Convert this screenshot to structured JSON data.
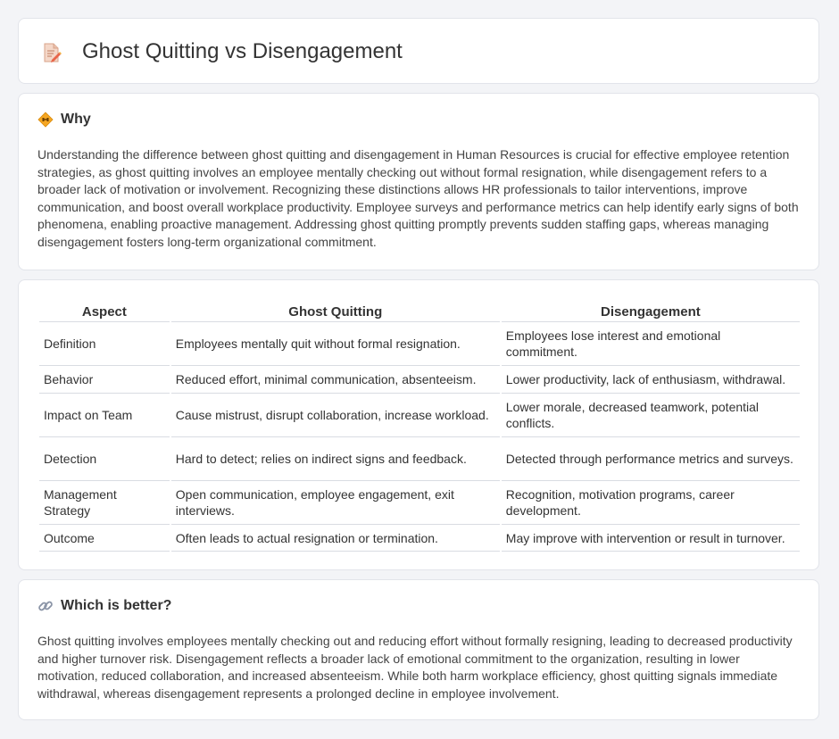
{
  "header": {
    "title": "Ghost Quitting vs Disengagement",
    "icon": "document-pencil-icon"
  },
  "why": {
    "heading": "Why",
    "icon": "road-sign-icon",
    "text": "Understanding the difference between ghost quitting and disengagement in Human Resources is crucial for effective employee retention strategies, as ghost quitting involves an employee mentally checking out without formal resignation, while disengagement refers to a broader lack of motivation or involvement. Recognizing these distinctions allows HR professionals to tailor interventions, improve communication, and boost overall workplace productivity. Employee surveys and performance metrics can help identify early signs of both phenomena, enabling proactive management. Addressing ghost quitting promptly prevents sudden staffing gaps, whereas managing disengagement fosters long-term organizational commitment."
  },
  "table": {
    "headers": [
      "Aspect",
      "Ghost Quitting",
      "Disengagement"
    ],
    "rows": [
      [
        "Definition",
        "Employees mentally quit without formal resignation.",
        "Employees lose interest and emotional commitment."
      ],
      [
        "Behavior",
        "Reduced effort, minimal communication, absenteeism.",
        "Lower productivity, lack of enthusiasm, withdrawal."
      ],
      [
        "Impact on Team",
        "Cause mistrust, disrupt collaboration, increase workload.",
        "Lower morale, decreased teamwork, potential conflicts."
      ],
      [
        "Detection",
        "Hard to detect; relies on indirect signs and feedback.",
        "Detected through performance metrics and surveys."
      ],
      [
        "Management Strategy",
        "Open communication, employee engagement, exit interviews.",
        "Recognition, motivation programs, career development."
      ],
      [
        "Outcome",
        "Often leads to actual resignation or termination.",
        "May improve with intervention or result in turnover."
      ]
    ]
  },
  "better": {
    "heading": "Which is better?",
    "icon": "link-icon",
    "text": "Ghost quitting involves employees mentally checking out and reducing effort without formally resigning, leading to decreased productivity and higher turnover risk. Disengagement reflects a broader lack of emotional commitment to the organization, resulting in lower motivation, reduced collaboration, and increased absenteeism. While both harm workplace efficiency, ghost quitting signals immediate withdrawal, whereas disengagement represents a prolonged decline in employee involvement."
  }
}
